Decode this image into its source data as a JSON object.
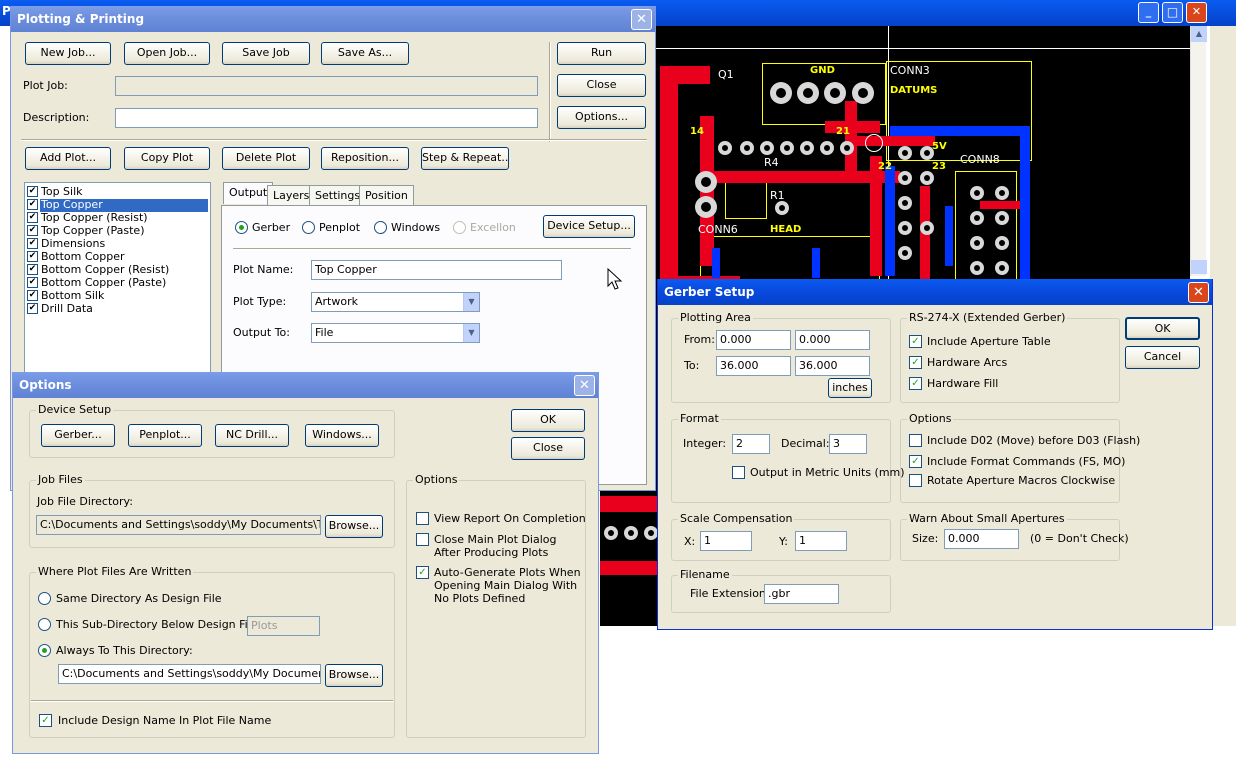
{
  "main_window": {
    "title_letter": "P"
  },
  "pcb": {
    "labels": [
      "Q1",
      "GND",
      "CONN3",
      "DATUMS",
      "14",
      "21",
      "5V",
      "23",
      "22",
      "CONN8",
      "R4",
      "R1",
      "CONN6",
      "HEAD"
    ]
  },
  "plotting": {
    "title": "Plotting & Printing",
    "buttons": {
      "new_job": "New Job...",
      "open_job": "Open Job...",
      "save_job": "Save Job",
      "save_as": "Save As...",
      "run": "Run",
      "close": "Close",
      "options": "Options...",
      "add_plot": "Add Plot...",
      "copy_plot": "Copy Plot",
      "delete_plot": "Delete Plot",
      "reposition": "Reposition...",
      "step_repeat": "Step & Repeat...",
      "device_setup": "Device Setup..."
    },
    "plot_job_label": "Plot Job:",
    "plot_job_value": "",
    "description_label": "Description:",
    "description_value": "",
    "layers": [
      "Top Silk",
      "Top Copper",
      "Top Copper (Resist)",
      "Top Copper (Paste)",
      "Dimensions",
      "Bottom Copper",
      "Bottom Copper (Resist)",
      "Bottom Copper (Paste)",
      "Bottom Silk",
      "Drill Data"
    ],
    "tabs": [
      "Output",
      "Layers",
      "Settings",
      "Position"
    ],
    "output_types": [
      "Gerber",
      "Penplot",
      "Windows",
      "Excellon"
    ],
    "plot_name_label": "Plot Name:",
    "plot_name_value": "Top Copper",
    "plot_type_label": "Plot Type:",
    "plot_type_value": "Artwork",
    "output_to_label": "Output To:",
    "output_to_value": "File"
  },
  "options": {
    "title": "Options",
    "device_setup_legend": "Device Setup",
    "buttons": {
      "gerber": "Gerber...",
      "penplot": "Penplot...",
      "nc_drill": "NC Drill...",
      "windows": "Windows...",
      "ok": "OK",
      "close": "Close",
      "browse1": "Browse...",
      "browse2": "Browse..."
    },
    "job_files_legend": "Job Files",
    "job_dir_label": "Job File Directory:",
    "job_dir_value": "C:\\Documents and Settings\\soddy\\My Documents\\TEMP",
    "where_legend": "Where Plot Files Are Written",
    "radio_same": "Same Directory As Design File",
    "radio_sub": "This Sub-Directory Below Design File:",
    "sub_value": "Plots",
    "radio_always": "Always To This Directory:",
    "always_value": "C:\\Documents and Settings\\soddy\\My Documents\\TE",
    "include_design": "Include Design Name In Plot File Name",
    "options_legend": "Options",
    "opt_view": "View Report On Completion",
    "opt_close1": "Close Main Plot Dialog",
    "opt_close2": "After Producing Plots",
    "opt_auto1": "Auto-Generate Plots When",
    "opt_auto2": "Opening Main Dialog With",
    "opt_auto3": "No Plots Defined"
  },
  "gerber": {
    "title": "Gerber Setup",
    "ok": "OK",
    "cancel": "Cancel",
    "plotting_area": "Plotting Area",
    "from_label": "From:",
    "from_x": "0.000",
    "from_y": "0.000",
    "to_label": "To:",
    "to_x": "36.000",
    "to_y": "36.000",
    "inches": "inches",
    "rs_legend": "RS-274-X (Extended Gerber)",
    "rs_items": [
      "Include Aperture Table",
      "Hardware Arcs",
      "Hardware Fill"
    ],
    "format_legend": "Format",
    "integer_label": "Integer:",
    "integer_value": "2",
    "decimal_label": "Decimal:",
    "decimal_value": "3",
    "metric_label": "Output in Metric Units (mm)",
    "options_legend": "Options",
    "opt_items": [
      "Include D02 (Move) before D03 (Flash)",
      "Include Format Commands (FS, MO)",
      "Rotate Aperture Macros Clockwise"
    ],
    "scale_legend": "Scale Compensation",
    "x_label": "X:",
    "x_value": "1",
    "y_label": "Y:",
    "y_value": "1",
    "warn_legend": "Warn About Small Apertures",
    "size_label": "Size:",
    "size_value": "0.000",
    "size_hint": "(0 = Don't Check)",
    "filename_legend": "Filename",
    "ext_label": "File Extension:",
    "ext_value": ".gbr"
  }
}
